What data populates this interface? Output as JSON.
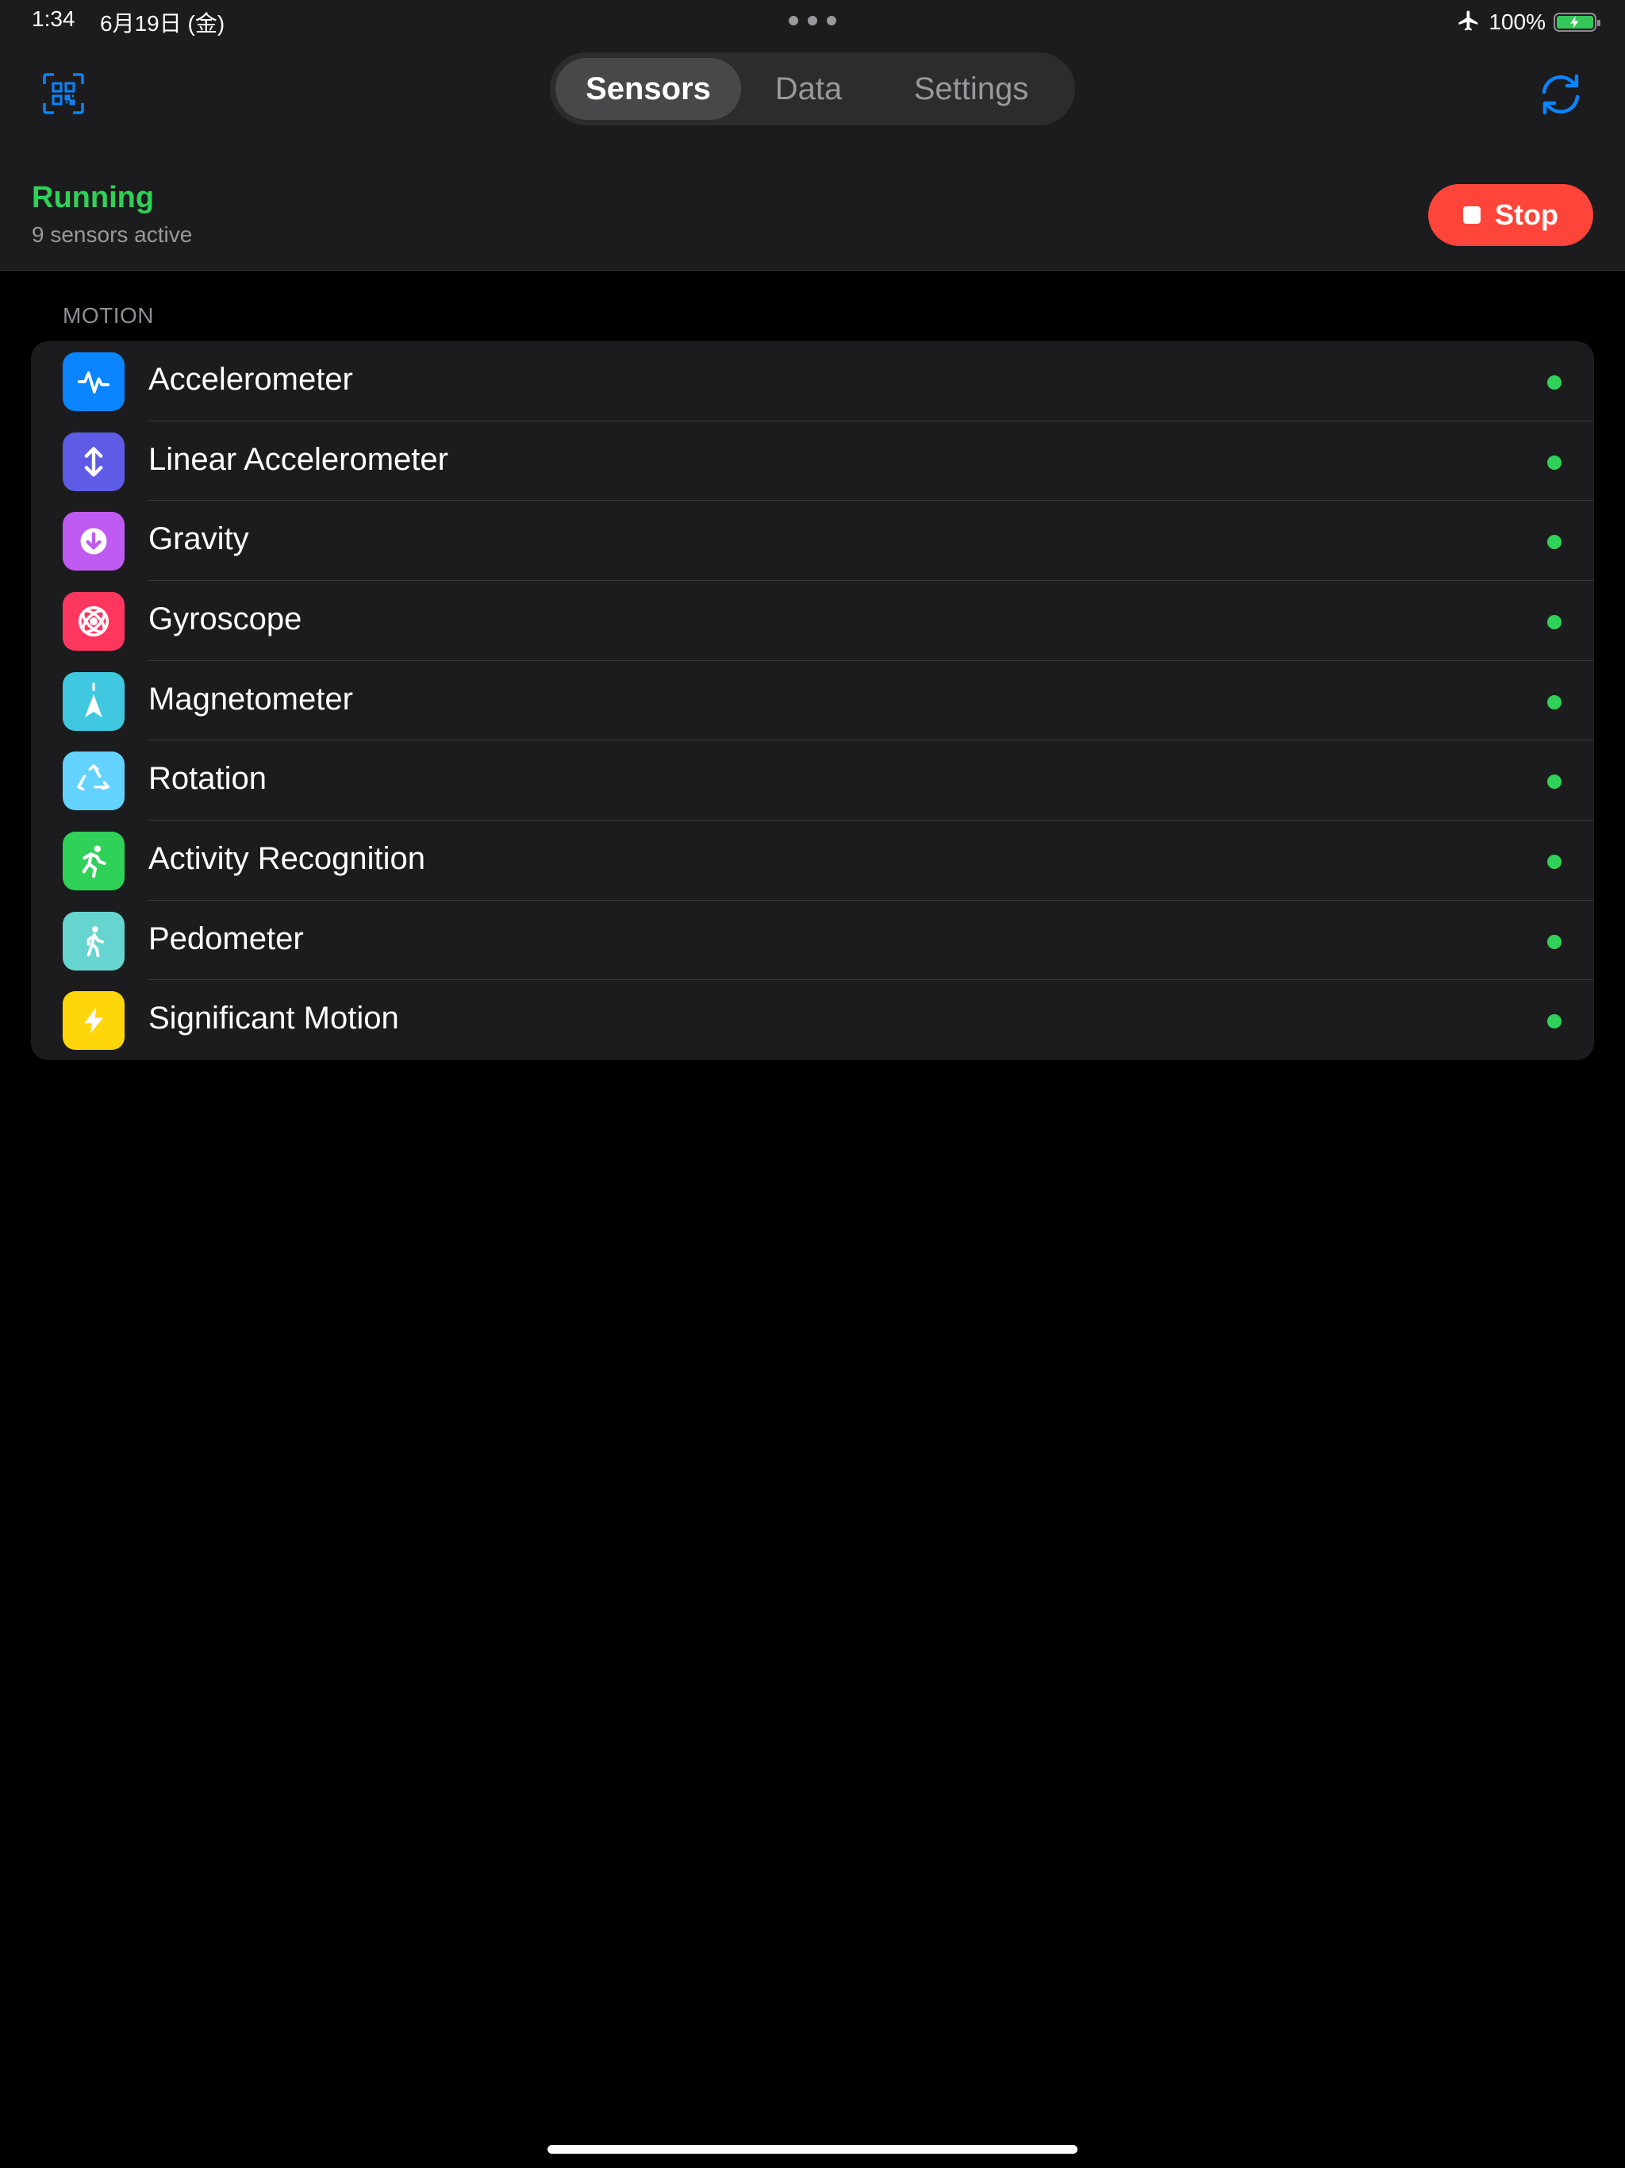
{
  "status_bar": {
    "time": "1:34",
    "date": "6月19日 (金)",
    "battery_percent_text": "100%",
    "battery_level": 1.0,
    "icons": [
      "airplane-mode-icon",
      "battery-charging-icon"
    ]
  },
  "nav": {
    "qr_icon": "qr-scan-icon",
    "refresh_icon": "refresh-icon",
    "tabs": [
      {
        "label": "Sensors",
        "active": true
      },
      {
        "label": "Data",
        "active": false
      },
      {
        "label": "Settings",
        "active": false
      }
    ]
  },
  "run_state": {
    "status": "Running",
    "subtitle": "9 sensors active",
    "stop_label": "Stop",
    "status_color": "#30d158",
    "stop_color": "#ff453a"
  },
  "section": {
    "title": "MOTION",
    "sensors": [
      {
        "name": "Accelerometer",
        "icon": "waveform-icon",
        "color": "#0a84ff",
        "active": true
      },
      {
        "name": "Linear Accelerometer",
        "icon": "up-down-arrows-icon",
        "color": "#5e5ce6",
        "active": true
      },
      {
        "name": "Gravity",
        "icon": "arrow-down-circle-icon",
        "color": "#bf5af2",
        "active": true
      },
      {
        "name": "Gyroscope",
        "icon": "gyroscope-icon",
        "color": "#ff375f",
        "active": true
      },
      {
        "name": "Magnetometer",
        "icon": "compass-arrow-icon",
        "color": "#40c8e0",
        "active": true
      },
      {
        "name": "Rotation",
        "icon": "rotation-arrows-icon",
        "color": "#64d2ff",
        "active": true
      },
      {
        "name": "Activity Recognition",
        "icon": "running-figure-icon",
        "color": "#30d158",
        "active": true
      },
      {
        "name": "Pedometer",
        "icon": "walking-figure-icon",
        "color": "#66d4cf",
        "active": true
      },
      {
        "name": "Significant Motion",
        "icon": "lightning-bolt-icon",
        "color": "#ffd60a",
        "active": true
      }
    ]
  }
}
